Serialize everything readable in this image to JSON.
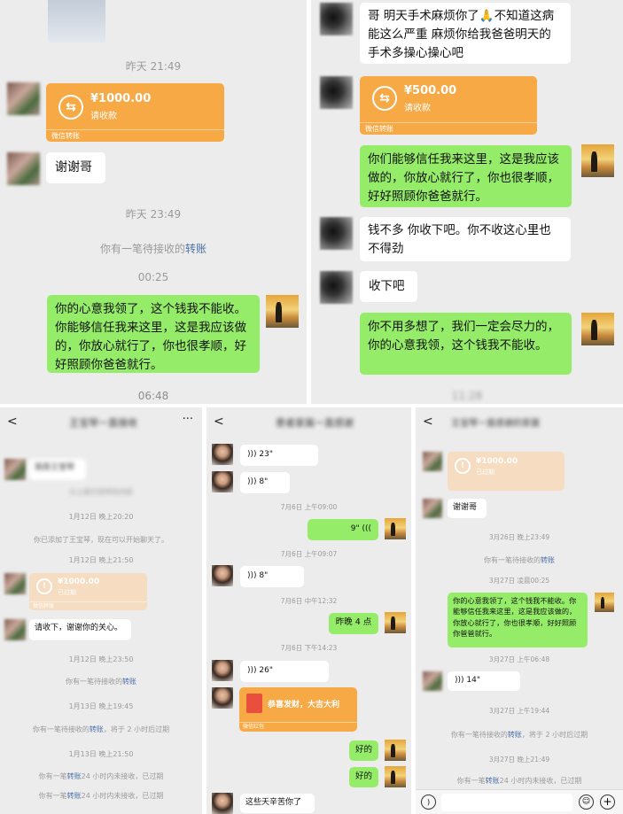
{
  "panel1": {
    "time1": "昨天 21:49",
    "transfer": {
      "amount": "¥1000.00",
      "status": "请收款",
      "footer": "微信转账"
    },
    "msg_thanks": "谢谢哥",
    "time2": "昨天 23:49",
    "pending_prefix": "你有一笔待接收的",
    "pending_link": "转账",
    "time3": "00:25",
    "reply": "你的心意我领了，这个钱我不能收。你能够信任我来这里，这是我应该做的，你放心就行了，你也很孝顺，好好照顾你爸爸就行。",
    "time4": "06:48"
  },
  "panel2": {
    "msg1": "哥 明天手术麻烦你了🙏不知道这病能这么严重 麻烦你给我爸爸明天的手术多操心操心吧",
    "transfer": {
      "amount": "¥500.00",
      "status": "请收款",
      "footer": "微信转账"
    },
    "reply1": "你们能够信任我来这里，这是我应该做的，你放心就行了，你也很孝顺，好好照顾你爸爸就行。",
    "msg2": "钱不多 你收下吧。你不收这心里也不得劲",
    "msg3": "收下吧",
    "reply2": "你不用多想了，我们一定会尽力的，你的心意我领，这个钱我不能收。",
    "time_bottom": "11:28"
  },
  "panel3": {
    "back": "<",
    "more": "···",
    "title": "王宝琴一直接收",
    "msg1": "我是王宝琴",
    "hint1": "以上是打招呼的内容",
    "time1": "1月12日 晚上20:20",
    "sys1": "你已添加了王宝琴，现在可以开始聊天了。",
    "time2": "1月12日 晚上21:50",
    "transfer": {
      "amount": "¥1000.00",
      "status": "已过期",
      "footer": "微信转账"
    },
    "msg2": "请收下，谢谢你的关心。",
    "time3": "1月12日 晚上23:50",
    "pending_prefix": "你有一笔待接收的",
    "pending_link": "转账",
    "time4": "1月13日 晚上19:45",
    "sys2_prefix": "你有一笔待接收的",
    "sys2_link": "转账",
    "sys2_suffix": "，将于 2 小时后过期",
    "time5": "1月13日 晚上21:50",
    "sys3_prefix": "你有一笔",
    "sys3_link": "转账",
    "sys3_suffix": "24 小时内未接收，已过期",
    "sys4_prefix": "你有一笔",
    "sys4_link": "转账",
    "sys4_suffix": "24 小时内未接收，已过期"
  },
  "panel4": {
    "back": "<",
    "title": "患者家属一直感谢",
    "voice1": "23\"",
    "voice2": "8\"",
    "time1": "7月6日 上午09:00",
    "voice3": "9\"",
    "time2": "7月6日 上午09:07",
    "voice4": "8\"",
    "time3": "7月6日 中午12:32",
    "msg1": "昨晚 4 点",
    "time4": "7月6日 下午14:23",
    "voice5": "26\"",
    "redpacket": {
      "text": "恭喜发财，大吉大利",
      "footer": "微信红包"
    },
    "msg2": "好的",
    "msg3": "好的",
    "msg4": "这些天辛苦你了"
  },
  "panel5": {
    "back": "<",
    "title": "王宝琴一直感谢的家属",
    "transfer": {
      "amount": "¥1000.00",
      "status": "已过期"
    },
    "msg1": "谢谢哥",
    "time1": "3月26日 晚上23:49",
    "pending_prefix": "你有一笔待接收的",
    "pending_link": "转账",
    "time2": "3月27日 凌晨00:25",
    "reply": "你的心意我领了，这个钱我不能收。你能够信任我来这里，这是我应该做的，你放心就行了，你也很孝顺，好好照顾你爸爸就行。",
    "time3": "3月27日 上午06:48",
    "voice1": "14\"",
    "time4": "3月27日 上午19:44",
    "sys1_prefix": "你有一笔待接收的",
    "sys1_link": "转账",
    "sys1_suffix": "，将于 2 小时后过期",
    "time5": "3月27日 晚上21:49",
    "sys2_prefix": "你有一笔",
    "sys2_link": "转账",
    "sys2_suffix": "24 小时内未接收，已过期"
  },
  "colors": {
    "green_bubble": "#95ec69",
    "transfer_orange": "#f7a945",
    "link_blue": "#4b6fa8"
  }
}
